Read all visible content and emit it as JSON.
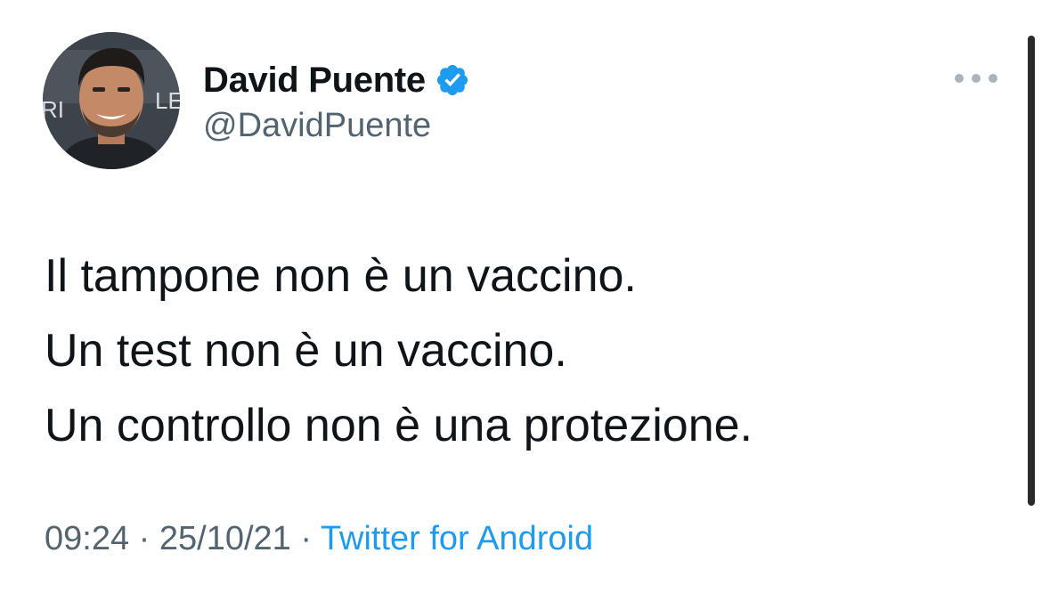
{
  "tweet": {
    "author": {
      "display_name": "David Puente",
      "handle": "@DavidPuente",
      "verified": true,
      "avatar_background_text": "RI LE"
    },
    "more_icon": "more-horizontal-icon",
    "lines": [
      "Il tampone non è un vaccino.",
      "Un test non è un vaccino.",
      "Un controllo non è una protezione."
    ],
    "time": "09:24",
    "separator": " · ",
    "date": "25/10/21",
    "source": "Twitter for Android"
  },
  "colors": {
    "text": "#0f1419",
    "secondary_text": "#536471",
    "accent": "#1d9bf0",
    "background": "#ffffff"
  }
}
